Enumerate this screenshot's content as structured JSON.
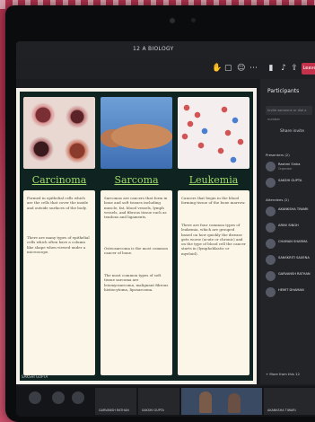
{
  "window": {
    "title": "12 A BIOLOGY"
  },
  "toolbar": {
    "icons": [
      "hand-raise-icon",
      "chat-icon",
      "reactions-icon",
      "more-icon",
      "camera-icon",
      "mic-icon",
      "share-icon"
    ],
    "leave_label": "Leave"
  },
  "slide": {
    "columns": [
      {
        "title": "Carcinoma",
        "bullets": [
          "Formed in epithelial cells which are the cells that cover the inside and outside surfaces of the body.",
          "There are many types of epithelial cells which often have a column like shape when viewed under a microscope."
        ]
      },
      {
        "title": "Sarcoma",
        "bullets": [
          "Sarcomas are cancers that form in bone and soft tissues including muscle, fat, blood vessels, lymph vessels, and fibrous tissue such as tendons and ligaments.",
          "Osteosarcoma is the most common cancer of bone.",
          "The most common types of soft tissue sarcoma are leiomyosarcoma, malignant fibrous histiocytoma, liposarcoma."
        ]
      },
      {
        "title": "Leukemia",
        "bullets": [
          "Cancers that begin in the blood forming tissue of the bone marrow.",
          "There are four common types of leukemia, which are grouped based on how quickly the disease gets worse (acute or chronic) and on the type of blood cell the cancer starts in (lymphoblastic or myeloid)."
        ]
      }
    ]
  },
  "panel": {
    "title": "Participants",
    "invite_placeholder": "Invite someone or dial a number",
    "share_invite": "Share invite",
    "presenters_label": "Presenters (2)",
    "attendees_label": "Attendees (2)",
    "presenters": [
      {
        "name": "Rashmi Sinha",
        "role": "Organiser"
      },
      {
        "name": "SAKSHI GUPTA",
        "role": ""
      }
    ],
    "attendees": [
      {
        "name": "AKANKSHA TIWARI"
      },
      {
        "name": "ARNV SINGH"
      },
      {
        "name": "CHAMAN SHARMA"
      },
      {
        "name": "SANSKRITI SAXENA"
      },
      {
        "name": "GARVANSH RATHAN"
      },
      {
        "name": "HEMIT DHAMAN"
      }
    ],
    "more_text": "+ More from this 12"
  },
  "strip": {
    "tiles": [
      {
        "label": "GARVANSH RATHAN"
      },
      {
        "label": "SAKSHI GUPTA"
      },
      {
        "label": "AKANKSHA TIWARI"
      }
    ]
  },
  "meeting": {
    "presenter_badge": "SAKSHI GUPTA"
  }
}
